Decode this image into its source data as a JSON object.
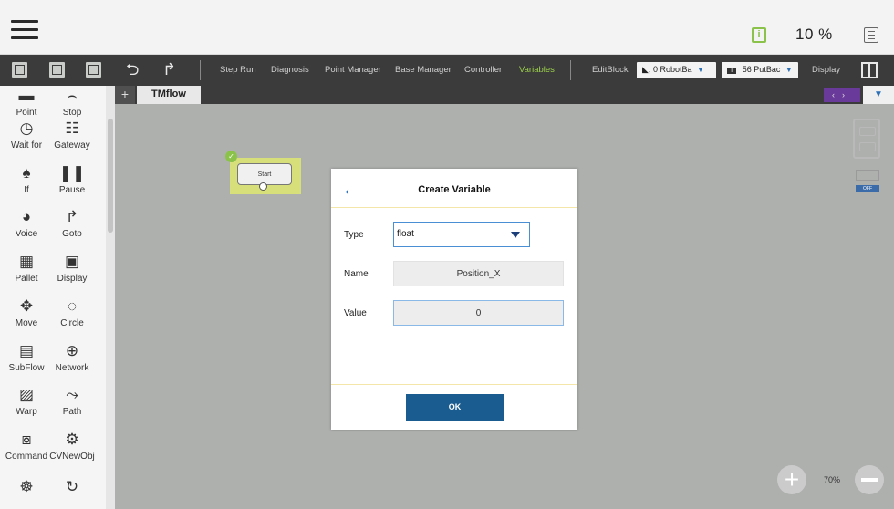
{
  "header": {
    "menu_icon": "hamburger-icon",
    "info_icon": "info-icon",
    "info_symbol": "i",
    "speed": "10 %",
    "settings_icon": "menu-icon"
  },
  "toolbar": {
    "undo_icon": "undo-arrow-icon",
    "redo_icon": "redo-arrow-icon",
    "links": [
      "Step Run",
      "Diagnosis",
      "Point Manager",
      "Base Manager",
      "Controller",
      "Variables"
    ],
    "active_link": "Variables",
    "edit_block": "EditBlock",
    "robot_base": "0 RobotBa",
    "tool_badge": "T",
    "tool": "56 PutBac",
    "display": "Display"
  },
  "sidebar": {
    "nodes": [
      {
        "label": "Point",
        "icon": "point-icon"
      },
      {
        "label": "Stop",
        "icon": "stop-icon"
      },
      {
        "label": "Wait for",
        "icon": "wait-for-icon"
      },
      {
        "label": "Gateway",
        "icon": "gateway-icon"
      },
      {
        "label": "If",
        "icon": "if-icon"
      },
      {
        "label": "Pause",
        "icon": "pause-icon"
      },
      {
        "label": "Voice",
        "icon": "voice-icon"
      },
      {
        "label": "Goto",
        "icon": "goto-icon"
      },
      {
        "label": "Pallet",
        "icon": "pallet-icon"
      },
      {
        "label": "Display",
        "icon": "display-icon"
      },
      {
        "label": "Move",
        "icon": "move-icon"
      },
      {
        "label": "Circle",
        "icon": "circle-icon"
      },
      {
        "label": "SubFlow",
        "icon": "subflow-icon"
      },
      {
        "label": "Network",
        "icon": "network-icon"
      },
      {
        "label": "Warp",
        "icon": "warp-icon"
      },
      {
        "label": "Path",
        "icon": "path-icon"
      },
      {
        "label": "Command",
        "icon": "command-icon"
      },
      {
        "label": "CVNewObj",
        "icon": "cvnewobj-icon"
      }
    ]
  },
  "canvas": {
    "tab_add": "+",
    "tab_label": "TMflow",
    "start_node": "Start",
    "zoom": "70%"
  },
  "dialog": {
    "title": "Create Variable",
    "type_label": "Type",
    "type_value": "float",
    "name_label": "Name",
    "name_value": "Position_X",
    "value_label": "Value",
    "value_value": "0",
    "ok_label": "OK"
  },
  "colors": {
    "active_link": "#9bd04a",
    "accent_blue": "#2b6fb6",
    "ok_button": "#1a5c8f",
    "start_highlight": "#d6df7a"
  }
}
